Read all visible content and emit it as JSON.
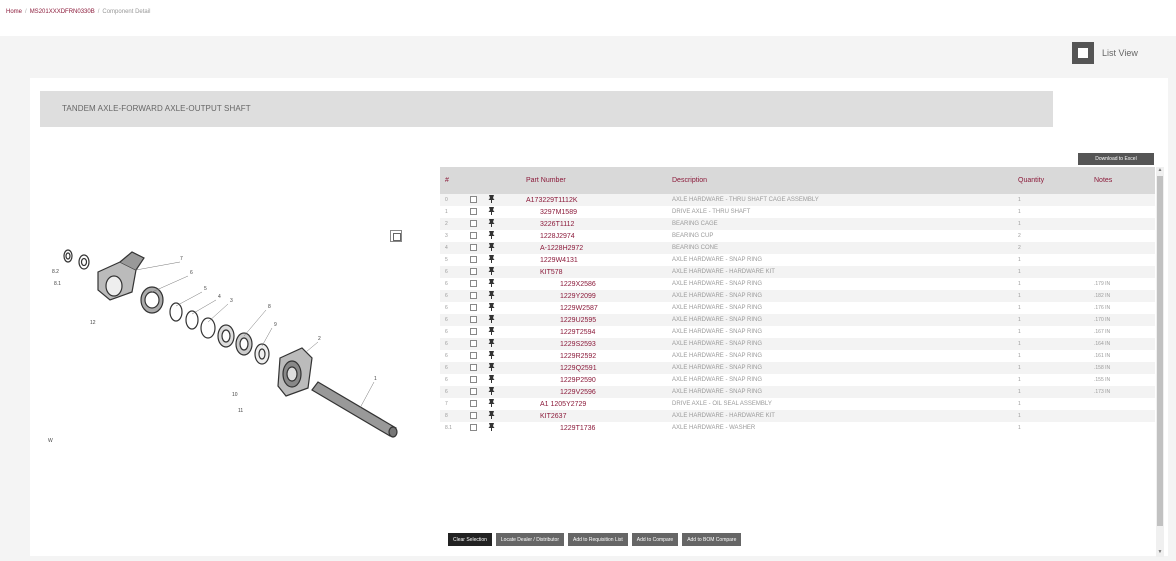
{
  "breadcrumb": {
    "home": "Home",
    "model": "MS201XXXDFRN0330B",
    "current": "Component Detail"
  },
  "list_view": {
    "label": "List View",
    "icon": "list-view-icon"
  },
  "section": {
    "title": "TANDEM AXLE-FORWARD AXLE-OUTPUT SHAFT"
  },
  "download_label": "Download to Excel",
  "table": {
    "headers": {
      "num": "#",
      "part_number": "Part Number",
      "description": "Description",
      "quantity": "Quantity",
      "notes": "Notes"
    },
    "rows": [
      {
        "num": "0",
        "part": "A173229T1112K",
        "desc": "AXLE HARDWARE - THRU SHAFT CAGE ASSEMBLY",
        "qty": "1",
        "notes": "",
        "level": 0
      },
      {
        "num": "1",
        "part": "3297M1589",
        "desc": "DRIVE AXLE - THRU SHAFT",
        "qty": "1",
        "notes": "",
        "level": 1
      },
      {
        "num": "2",
        "part": "3226T1112",
        "desc": "BEARING CAGE",
        "qty": "1",
        "notes": "",
        "level": 1
      },
      {
        "num": "3",
        "part": "1228J2974",
        "desc": "BEARING CUP",
        "qty": "2",
        "notes": "",
        "level": 1
      },
      {
        "num": "4",
        "part": "A-1228H2972",
        "desc": "BEARING CONE",
        "qty": "2",
        "notes": "",
        "level": 1
      },
      {
        "num": "5",
        "part": "1229W4131",
        "desc": "AXLE HARDWARE - SNAP RING",
        "qty": "1",
        "notes": "",
        "level": 1
      },
      {
        "num": "6",
        "part": "KIT578",
        "desc": "AXLE HARDWARE - HARDWARE KIT",
        "qty": "1",
        "notes": "",
        "level": 1
      },
      {
        "num": "6",
        "part": "1229X2586",
        "desc": "AXLE HARDWARE - SNAP RING",
        "qty": "1",
        "notes": ".179 IN",
        "level": 2
      },
      {
        "num": "6",
        "part": "1229Y2099",
        "desc": "AXLE HARDWARE - SNAP RING",
        "qty": "1",
        "notes": ".182 IN",
        "level": 2
      },
      {
        "num": "6",
        "part": "1229W2587",
        "desc": "AXLE HARDWARE - SNAP RING",
        "qty": "1",
        "notes": ".176 IN",
        "level": 2
      },
      {
        "num": "6",
        "part": "1229U2595",
        "desc": "AXLE HARDWARE - SNAP RING",
        "qty": "1",
        "notes": ".170 IN",
        "level": 2
      },
      {
        "num": "6",
        "part": "1229T2594",
        "desc": "AXLE HARDWARE - SNAP RING",
        "qty": "1",
        "notes": ".167 IN",
        "level": 2
      },
      {
        "num": "6",
        "part": "1229S2593",
        "desc": "AXLE HARDWARE - SNAP RING",
        "qty": "1",
        "notes": ".164 IN",
        "level": 2
      },
      {
        "num": "6",
        "part": "1229R2592",
        "desc": "AXLE HARDWARE - SNAP RING",
        "qty": "1",
        "notes": ".161 IN",
        "level": 2
      },
      {
        "num": "6",
        "part": "1229Q2591",
        "desc": "AXLE HARDWARE - SNAP RING",
        "qty": "1",
        "notes": ".158 IN",
        "level": 2
      },
      {
        "num": "6",
        "part": "1229P2590",
        "desc": "AXLE HARDWARE - SNAP RING",
        "qty": "1",
        "notes": ".155 IN",
        "level": 2
      },
      {
        "num": "6",
        "part": "1229V2596",
        "desc": "AXLE HARDWARE - SNAP RING",
        "qty": "1",
        "notes": ".173 IN",
        "level": 2
      },
      {
        "num": "7",
        "part": "A1 1205Y2729",
        "desc": "DRIVE AXLE - OIL SEAL ASSEMBLY",
        "qty": "1",
        "notes": "",
        "level": 1
      },
      {
        "num": "8",
        "part": "KIT2637",
        "desc": "AXLE HARDWARE - HARDWARE KIT",
        "qty": "1",
        "notes": "",
        "level": 1
      },
      {
        "num": "8.1",
        "part": "1229T1736",
        "desc": "AXLE HARDWARE - WASHER",
        "qty": "1",
        "notes": "",
        "level": 2
      }
    ]
  },
  "diagram_callouts": {
    "c1": "1",
    "c2": "2",
    "c3": "3",
    "c4": "4",
    "c5": "5",
    "c6": "6",
    "c7": "7",
    "c8": "8",
    "c81": "8.1",
    "c82": "8.2",
    "c9": "9",
    "c10": "10",
    "c11": "11",
    "c12": "12",
    "cw": "W"
  },
  "buttons": {
    "clear": "Clear Selection",
    "locate": "Locate Dealer / Distributor",
    "requisition": "Add to Requisition List",
    "compare": "Add to Compare",
    "bom": "Add to BOM Compare"
  },
  "colors": {
    "accent": "#8b1a3a",
    "header_bg": "#dedede",
    "button_dark": "#222222",
    "button_gray": "#666666"
  }
}
